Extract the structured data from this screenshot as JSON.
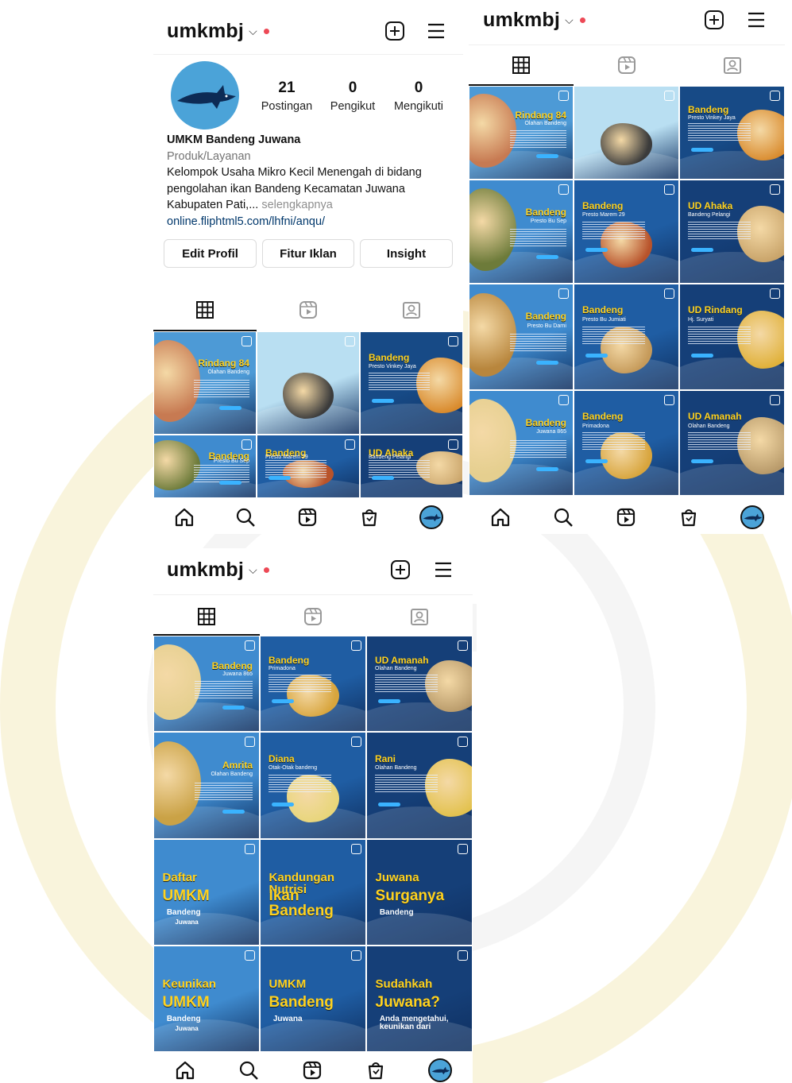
{
  "username": "umkmbj",
  "profile": {
    "name": "UMKM Bandeng Juwana",
    "category": "Produk/Layanan",
    "bio_line1": "Kelompok Usaha Mikro Kecil Menengah di bidang",
    "bio_line2": "pengolahan ikan Bandeng Kecamatan Juwana",
    "bio_line3": "Kabupaten Pati,...",
    "more": "selengkapnya",
    "link": "online.fliphtml5.com/lhfni/anqu/"
  },
  "stats": [
    {
      "value": "21",
      "label": "Postingan"
    },
    {
      "value": "0",
      "label": "Pengikut"
    },
    {
      "value": "0",
      "label": "Mengikuti"
    }
  ],
  "buttons": {
    "edit": "Edit Profil",
    "ads": "Fitur Iklan",
    "insight": "Insight"
  },
  "icons": {
    "new_post": "plus-square-icon",
    "menu": "hamburger-menu-icon",
    "grid_tab": "grid-icon",
    "reels_tab": "reels-icon",
    "tagged_tab": "tagged-icon",
    "nav": [
      "home-icon",
      "search-icon",
      "reels-icon",
      "shop-icon",
      "profile-avatar"
    ]
  },
  "colors": {
    "accent_yellow": "#ffd21f",
    "deep_blue": "#17427a",
    "mid_blue": "#2f7fc1",
    "light_blue": "#7cc4ea",
    "notification_red": "#ed4956"
  },
  "posts_screen1": [
    {
      "title": "Rindang 84",
      "sub": "Olahan Bandeng",
      "bg": "#4d9ad6",
      "photo": "#c77a52"
    },
    {
      "title": "",
      "sub": "",
      "bg": "#b9dff2",
      "photo": "#3b3b3b"
    },
    {
      "title": "Bandeng",
      "sub": "Presto Vinkey Jaya",
      "bg": "#174a86",
      "photo": "#d98a2c"
    },
    {
      "title": "Bandeng",
      "sub": "Presto Bu Sep",
      "bg": "#3f8bcf",
      "photo": "#6d7b3a"
    },
    {
      "title": "Bandeng",
      "sub": "Presto Marem 29",
      "bg": "#1f5da3",
      "photo": "#b8532b"
    },
    {
      "title": "UD Ahaka",
      "sub": "Bandeng Pelangi",
      "bg": "#153f78",
      "photo": "#c9a46a"
    }
  ],
  "posts_screen2": [
    {
      "title": "Rindang 84",
      "sub": "Olahan Bandeng",
      "bg": "#4d9ad6",
      "photo": "#c77a52"
    },
    {
      "title": "",
      "sub": "",
      "bg": "#b9dff2",
      "photo": "#3b3b3b"
    },
    {
      "title": "Bandeng",
      "sub": "Presto Vinkey Jaya",
      "bg": "#174a86",
      "photo": "#d98a2c"
    },
    {
      "title": "Bandeng",
      "sub": "Presto Bu Sep",
      "bg": "#3f8bcf",
      "photo": "#6d7b3a"
    },
    {
      "title": "Bandeng",
      "sub": "Presto Marem 29",
      "bg": "#1f5da3",
      "photo": "#b8532b"
    },
    {
      "title": "UD Ahaka",
      "sub": "Bandeng Pelangi",
      "bg": "#153f78",
      "photo": "#c9a46a"
    },
    {
      "title": "Bandeng",
      "sub": "Presto Bu Darni",
      "bg": "#3f8bcf",
      "photo": "#b8863d"
    },
    {
      "title": "Bandeng",
      "sub": "Presto Bu Jumiati",
      "bg": "#1f5da3",
      "photo": "#c59a5a"
    },
    {
      "title": "UD Rindang",
      "sub": "Hj. Suryati",
      "bg": "#153f78",
      "photo": "#e0b13a"
    },
    {
      "title": "Bandeng",
      "sub": "Juwana 865",
      "bg": "#3f8bcf",
      "photo": "#e5cf8f"
    },
    {
      "title": "Bandeng",
      "sub": "Primadona",
      "bg": "#1f5da3",
      "photo": "#d8a53d"
    },
    {
      "title": "UD Amanah",
      "sub": "Olahan Bandeng",
      "bg": "#153f78",
      "photo": "#b89a6a"
    }
  ],
  "posts_screen3": [
    {
      "title": "Bandeng",
      "sub": "Juwana 865",
      "bg": "#3f8bcf",
      "photo": "#e5cf8f"
    },
    {
      "title": "Bandeng",
      "sub": "Primadona",
      "bg": "#1f5da3",
      "photo": "#d8a53d"
    },
    {
      "title": "UD Amanah",
      "sub": "Olahan Bandeng",
      "bg": "#153f78",
      "photo": "#b89a6a"
    },
    {
      "title": "Amrita",
      "sub": "Olahan Bandeng",
      "bg": "#3f8bcf",
      "photo": "#caa246"
    },
    {
      "title": "Diana",
      "sub": "Otak-Otak bandeng",
      "bg": "#1f5da3",
      "photo": "#e8d67a"
    },
    {
      "title": "Rani",
      "sub": "Olahan Bandeng",
      "bg": "#153f78",
      "photo": "#e3c24f"
    },
    {
      "title": "Daftar",
      "big": "UMKM",
      "sub": "Bandeng",
      "sub2": "Juwana",
      "bg": "#3f8bcf",
      "photo": ""
    },
    {
      "title": "Kandungan Nutrisi",
      "big": "Ikan Bandeng",
      "sub": "",
      "bg": "#1f5da3",
      "photo": ""
    },
    {
      "title": "Juwana",
      "big": "Surganya",
      "sub": "Bandeng",
      "bg": "#153f78",
      "photo": ""
    },
    {
      "title": "Keunikan",
      "big": "UMKM",
      "sub": "Bandeng",
      "sub2": "Juwana",
      "bg": "#3f8bcf",
      "photo": ""
    },
    {
      "title": "UMKM",
      "big": "Bandeng",
      "sub": "Juwana",
      "bg": "#1f5da3",
      "photo": ""
    },
    {
      "title": "Sudahkah",
      "sub": "Anda mengetahui, keunikan dari",
      "big": "Juwana?",
      "bg": "#153f78",
      "photo": ""
    }
  ]
}
